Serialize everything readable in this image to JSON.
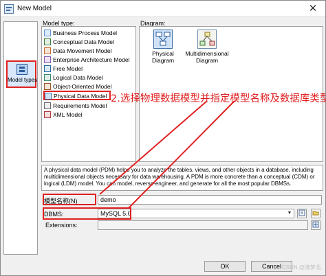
{
  "window": {
    "title": "New Model",
    "close_glyph": "✕"
  },
  "left_panel": {
    "model_types_label": "Model types"
  },
  "model_type": {
    "heading": "Model type:",
    "items": [
      {
        "label": "Business Process Model",
        "icon": "bpm-icon",
        "color": "#5b8fd6"
      },
      {
        "label": "Conceptual Data Model",
        "icon": "cdm-icon",
        "color": "#3a7a3a"
      },
      {
        "label": "Data Movement Model",
        "icon": "dmm-icon",
        "color": "#c86a2a"
      },
      {
        "label": "Enterprise Architecture Model",
        "icon": "eam-icon",
        "color": "#8a5ab0"
      },
      {
        "label": "Free Model",
        "icon": "free-model-icon",
        "color": "#2a6aa0"
      },
      {
        "label": "Logical Data Model",
        "icon": "ldm-icon",
        "color": "#3a8a6a"
      },
      {
        "label": "Object-Oriented Model",
        "icon": "oom-icon",
        "color": "#a05a2a"
      },
      {
        "label": "Physical Data Model",
        "icon": "pdm-icon",
        "color": "#3b6ea5"
      },
      {
        "label": "Requirements Model",
        "icon": "requirements-icon",
        "color": "#6a6a6a"
      },
      {
        "label": "XML Model",
        "icon": "xml-icon",
        "color": "#b03a3a"
      }
    ]
  },
  "diagram": {
    "heading": "Diagram:",
    "items": [
      {
        "label": "Physical Diagram",
        "icon": "physical-diagram-icon"
      },
      {
        "label": "Multidimensional Diagram",
        "icon": "multidimensional-diagram-icon"
      }
    ]
  },
  "description": "A physical data model (PDM) helps you to analyze the tables, views, and other objects in a database, including multidimensional objects necessary for data warehousing. A PDM is more concrete than a conceptual (CDM) or logical (LDM) model. You can model, reverse-engineer, and generate for all the most popular DBMSs.",
  "form": {
    "model_name_label": "模型名称(N)",
    "model_name_value": "demo",
    "dbms_label": "DBMS:",
    "dbms_value": "MySQL 5.0",
    "extensions_label": "Extensions:"
  },
  "buttons": {
    "ok": "OK",
    "cancel": "Cancel"
  },
  "annotation": "2.选择物理数据模型并指定模型名称及数据库类型",
  "watermark": "CSDN @清梦北",
  "colors": {
    "annotation_red": "#e02020",
    "selection_blue": "#cfe2f8"
  }
}
